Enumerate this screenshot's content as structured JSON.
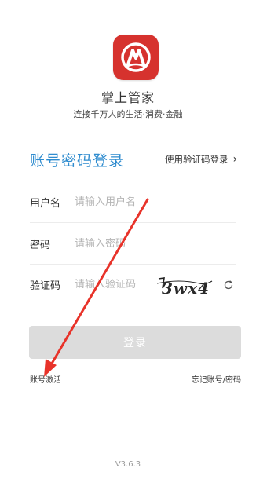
{
  "app": {
    "name": "掌上管家",
    "slogan": "连接千万人的生活·消费·金融",
    "logo_icon": "cmb-bank-logo-icon",
    "logo_color": "#d6322e"
  },
  "login": {
    "title": "账号密码登录",
    "switch_label": "使用验证码登录",
    "switch_icon": "chevron-right-icon",
    "accent_color": "#2f8ccf"
  },
  "fields": {
    "username": {
      "label": "用户名",
      "placeholder": "请输入用户名",
      "value": ""
    },
    "password": {
      "label": "密码",
      "placeholder": "请输入密码",
      "value": ""
    },
    "captcha": {
      "label": "验证码",
      "placeholder": "请输入验证码",
      "value": "",
      "image_text": "3wx4"
    }
  },
  "actions": {
    "login_label": "登录",
    "activate_label": "账号激活",
    "forgot_label": "忘记账号/密码"
  },
  "footer": {
    "version": "V3.6.3"
  },
  "annotation": {
    "type": "red-arrow",
    "color": "#e8332a",
    "points_to": "账号激活"
  }
}
